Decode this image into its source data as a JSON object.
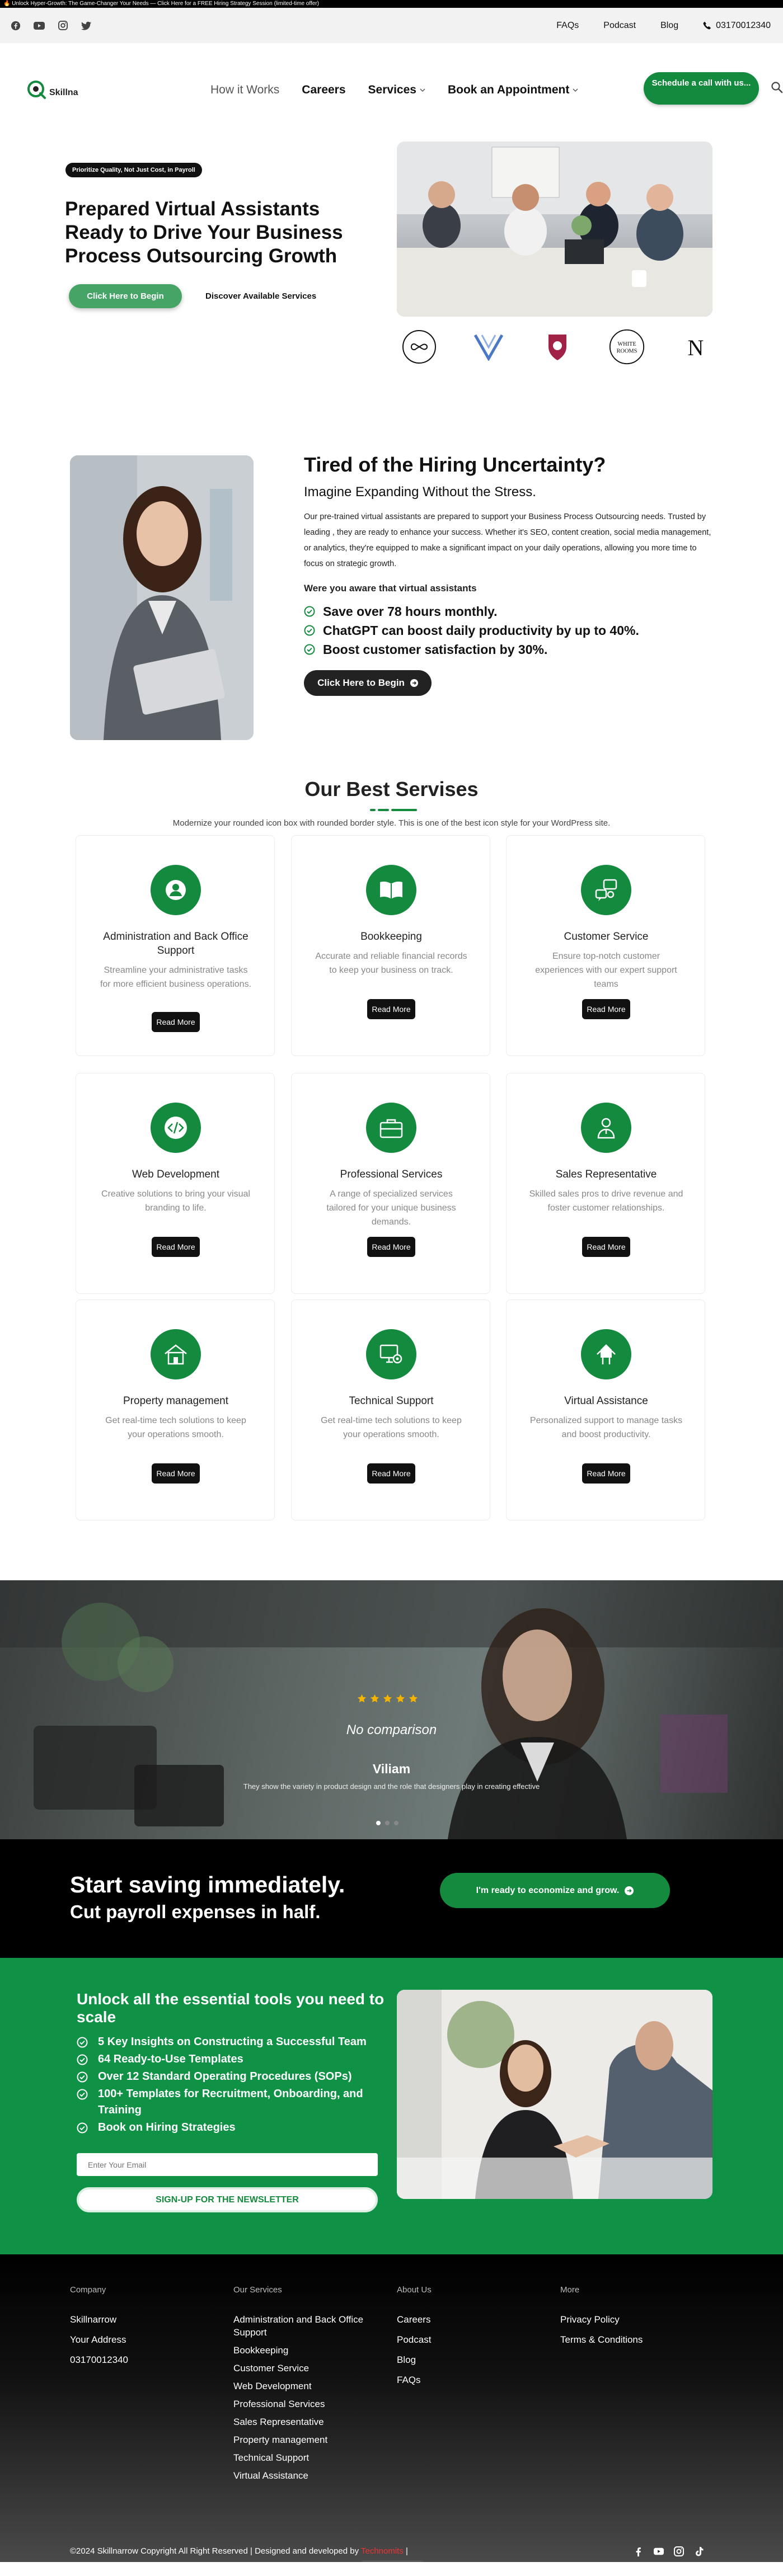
{
  "announcement": "🔥 Unlock Hyper-Growth: The Game-Changer Your Needs — Click Here for a FREE Hiring Strategy Session (limited-time offer)",
  "topbar": {
    "social_icons": [
      "facebook-icon",
      "youtube-icon",
      "instagram-icon",
      "twitter-icon"
    ],
    "links": [
      "FAQs",
      "Podcast",
      "Blog"
    ],
    "phone": "03170012340"
  },
  "header": {
    "logo_text": "Skillna",
    "nav": {
      "how": "How it Works",
      "careers": "Careers",
      "services": "Services",
      "booking": "Book an Appointment"
    },
    "cta": "Schedule a call with us..."
  },
  "hero": {
    "badge": "Prioritize Quality, Not Just Cost, in Payroll",
    "title": "Prepared Virtual Assistants Ready to Drive Your Business Process Outsourcing Growth",
    "primary_btn": "Click Here to Begin",
    "secondary_btn": "Discover Available Services",
    "partners": [
      "infinity",
      "V",
      "shield",
      "WHITE ROOMS",
      "N"
    ]
  },
  "hiring": {
    "title": "Tired of the Hiring Uncertainty?",
    "subtitle": "Imagine Expanding Without the Stress.",
    "paragraph": "Our pre-trained virtual assistants are prepared to support your Business Process Outsourcing needs. Trusted by leading , they are ready to enhance your success. Whether it's SEO, content creation, social media management, or analytics, they're equipped to make a significant impact on your daily operations, allowing you more time to focus on strategic growth.",
    "aware": "Were you aware that virtual assistants",
    "checks": [
      "Save over 78 hours monthly.",
      "ChatGPT can boost daily productivity by up to 40%.",
      "Boost customer satisfaction by 30%."
    ],
    "button": "Click Here to Begin"
  },
  "services": {
    "title": "Our Best Servises",
    "subtitle": "Modernize your rounded icon box with rounded border style. This is one of the best icon style for your WordPress site.",
    "read_more": "Read More",
    "cards": [
      {
        "title": "Administration and Back Office Support",
        "desc": "Streamline your administrative tasks for more efficient business operations.",
        "icon": "user-icon"
      },
      {
        "title": "Bookkeeping",
        "desc": "Accurate and reliable financial records to keep your business on track.",
        "icon": "book-icon"
      },
      {
        "title": "Customer Service",
        "desc": "Ensure top-notch customer experiences with our expert support teams",
        "icon": "chat-icon"
      },
      {
        "title": "Web Development",
        "desc": "Creative solutions to bring your visual branding to life.",
        "icon": "code-icon"
      },
      {
        "title": "Professional Services",
        "desc": "A range of specialized services tailored for your unique business demands.",
        "icon": "briefcase-icon"
      },
      {
        "title": "Sales Representative",
        "desc": "Skilled sales pros to drive revenue and foster customer relationships.",
        "icon": "sales-person-icon"
      },
      {
        "title": "Property management",
        "desc": "Get real-time tech solutions to keep your operations smooth.",
        "icon": "house-icon"
      },
      {
        "title": "Technical Support",
        "desc": "Get real-time tech solutions to keep your operations smooth.",
        "icon": "gear-monitor-icon"
      },
      {
        "title": "Virtual Assistance",
        "desc": "Personalized support to manage tasks and boost productivity.",
        "icon": "virtual-assistant-icon"
      }
    ]
  },
  "testimonial": {
    "stars": 5,
    "quote": "No comparison",
    "name": "Viliam",
    "role": "They show the variety in product design and the role that designers play in creating effective",
    "slide": 1,
    "slides": 3
  },
  "savings": {
    "line1": "Start saving immediately.",
    "line2": "Cut payroll expenses in half.",
    "button": "I'm ready to economize and grow."
  },
  "newsletter": {
    "title": "Unlock all the essential tools you need to scale",
    "items": [
      "5 Key Insights on Constructing a Successful Team",
      "64 Ready-to-Use Templates",
      "Over 12 Standard Operating Procedures (SOPs)",
      "100+ Templates for Recruitment, Onboarding, and Training",
      "Book on Hiring Strategies"
    ],
    "email_placeholder": "Enter Your Email",
    "button": "SIGN-UP FOR THE NEWSLETTER"
  },
  "footer": {
    "company": {
      "heading": "Company",
      "items": [
        "Skillnarrow",
        "Your Address",
        "03170012340"
      ]
    },
    "services": {
      "heading": "Our Services",
      "items": [
        "Administration and Back Office Support",
        "Bookkeeping",
        "Customer Service",
        "Web Development",
        "Professional Services",
        "Sales Representative",
        "Property management",
        "Technical Support",
        "Virtual Assistance"
      ]
    },
    "about": {
      "heading": "About Us",
      "items": [
        "Careers",
        "Podcast",
        "Blog",
        "FAQs"
      ]
    },
    "more": {
      "heading": "More",
      "items": [
        "Privacy Policy",
        "Terms & Conditions"
      ]
    },
    "copyright": "©2024 Skillnarrow Copyright All Right Reserved | Designed and developed by",
    "developer": "Technomits",
    "copyright_end": "|"
  },
  "colors": {
    "brand_green": "#138a3e",
    "news_green": "#0f9146",
    "dark": "#111111"
  }
}
